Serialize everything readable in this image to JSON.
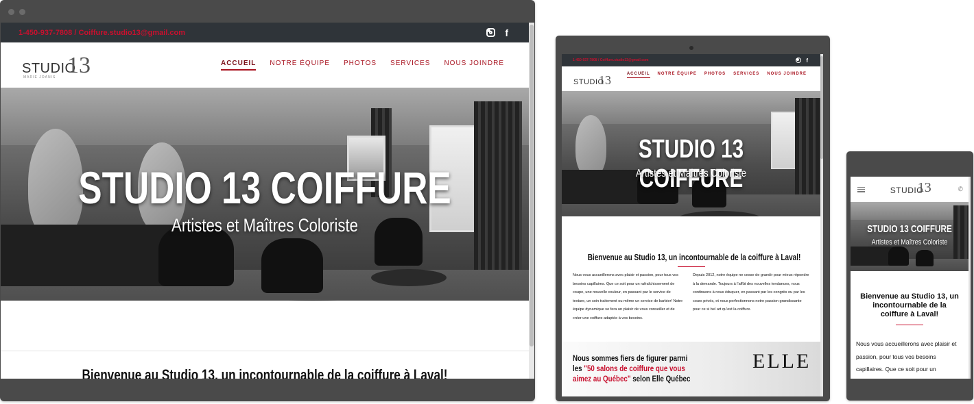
{
  "site": {
    "phone": "1-450-937-7808",
    "separator": " / ",
    "email": "Coiffure.studio13@gmail.com",
    "logo_word": "STUDIO",
    "logo_number": "13",
    "logo_tagline": "MARIE JOANIS",
    "nav": [
      "ACCUEIL",
      "NOTRE ÉQUIPE",
      "PHOTOS",
      "SERVICES",
      "NOUS JOINDRE"
    ],
    "hero_title": "STUDIO 13 COIFFURE",
    "hero_subtitle": "Artistes et Maîtres Coloriste",
    "welcome": "Bienvenue au Studio 13, un incontournable de la coiffure à Laval!",
    "col1": "Nous vous accueillerons avec plaisir et passion, pour tous vos besoins capillaires. Que ce soit pour un rafraîchissement de coupe, une nouvelle couleur, en passant par le service de texture, un soin traitement ou même un service de barbier! Notre équipe dynamique se fera un plaisir de vous conseiller et de créer une coiffure adaptée à vos besoins.",
    "col2": "Depuis 2012, notre équipe ne cesse de grandir pour mieux répondre à la demande. Toujours à l'affût des nouvelles tendances, nous continuons à nous éduquer, en passant par les congrès ou par les cours privés, et nous perfectionnons notre passion grandissante pour ce si bel art qu'est la coiffure.",
    "elle_pre": "Nous sommes fiers de figurer parmi les ",
    "elle_link": "\"50 salons de coiffure que vous aimez au Québec\"",
    "elle_post": " selon Elle Québec",
    "elle_logo": "ELLE",
    "mobile_intro": "Nous vous accueillerons avec plaisir et passion, pour tous vos besoins capillaires. Que ce soit pour un"
  },
  "icons": {
    "instagram": "instagram-icon",
    "facebook": "facebook-icon",
    "hamburger": "hamburger-menu-icon",
    "phone": "phone-icon"
  },
  "colors": {
    "accent": "#c8102e",
    "topbar": "#2f3439",
    "device_frame": "#4a4a4a"
  }
}
